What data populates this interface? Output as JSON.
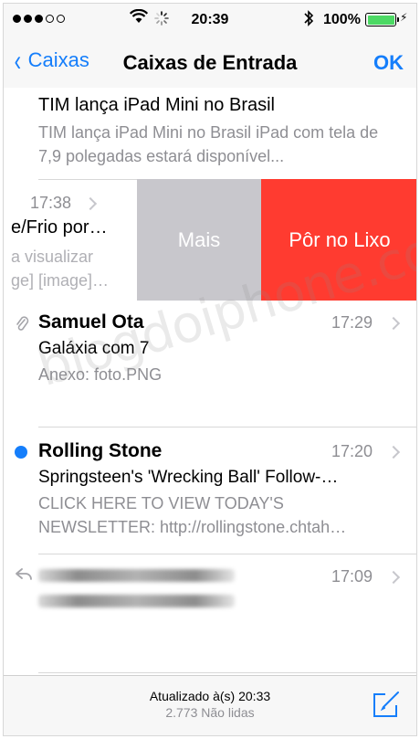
{
  "status_bar": {
    "time": "20:39",
    "battery_percent": "100%",
    "signal_dots_filled": 3,
    "signal_dots_total": 5
  },
  "nav": {
    "back_label": "Caixas",
    "title": "Caixas de Entrada",
    "done_label": "OK"
  },
  "messages": [
    {
      "sender": "",
      "subject": "TIM lança iPad Mini no Brasil",
      "preview": "TIM lança iPad Mini no Brasil iPad com tela de 7,9 polegadas estará disponível..."
    },
    {
      "time": "17:38",
      "subject": "e/Frio por…",
      "preview_line1": "a visualizar",
      "preview_line2": "ge] [image]…"
    },
    {
      "sender": "Samuel Ota",
      "time": "17:29",
      "subject": "Galáxia com 7",
      "preview": "Anexo: foto.PNG",
      "has_attachment": true
    },
    {
      "sender": "Rolling Stone",
      "time": "17:20",
      "subject": "Springsteen's 'Wrecking Ball' Follow-…",
      "preview": "CLICK HERE TO VIEW TODAY'S NEWSLETTER: http://rollingstone.chtah…",
      "unread": true
    },
    {
      "sender": "",
      "time": "17:09",
      "replied": true
    }
  ],
  "swipe_actions": {
    "more_label": "Mais",
    "trash_label": "Pôr no Lixo"
  },
  "watermark": "blogdoiphone.com",
  "toolbar": {
    "updated": "Atualizado à(s) 20:33",
    "unread_count": "2.773 Não lidas"
  },
  "colors": {
    "accent": "#157efb",
    "trash": "#ff3b30",
    "more": "#c8c7cc",
    "battery": "#4cd964"
  }
}
